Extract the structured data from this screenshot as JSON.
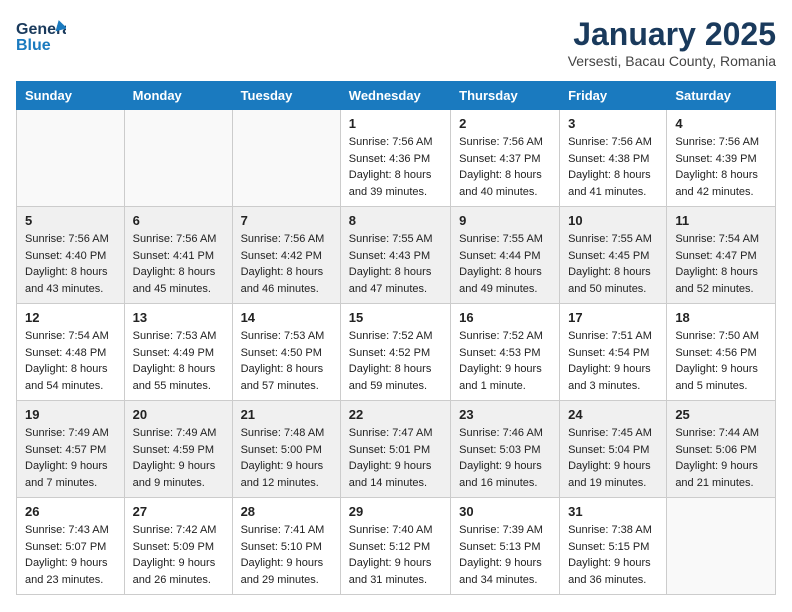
{
  "header": {
    "logo_general": "General",
    "logo_blue": "Blue",
    "title": "January 2025",
    "subtitle": "Versesti, Bacau County, Romania"
  },
  "weekdays": [
    "Sunday",
    "Monday",
    "Tuesday",
    "Wednesday",
    "Thursday",
    "Friday",
    "Saturday"
  ],
  "weeks": [
    [
      {
        "day": "",
        "info": ""
      },
      {
        "day": "",
        "info": ""
      },
      {
        "day": "",
        "info": ""
      },
      {
        "day": "1",
        "info": "Sunrise: 7:56 AM\nSunset: 4:36 PM\nDaylight: 8 hours\nand 39 minutes."
      },
      {
        "day": "2",
        "info": "Sunrise: 7:56 AM\nSunset: 4:37 PM\nDaylight: 8 hours\nand 40 minutes."
      },
      {
        "day": "3",
        "info": "Sunrise: 7:56 AM\nSunset: 4:38 PM\nDaylight: 8 hours\nand 41 minutes."
      },
      {
        "day": "4",
        "info": "Sunrise: 7:56 AM\nSunset: 4:39 PM\nDaylight: 8 hours\nand 42 minutes."
      }
    ],
    [
      {
        "day": "5",
        "info": "Sunrise: 7:56 AM\nSunset: 4:40 PM\nDaylight: 8 hours\nand 43 minutes."
      },
      {
        "day": "6",
        "info": "Sunrise: 7:56 AM\nSunset: 4:41 PM\nDaylight: 8 hours\nand 45 minutes."
      },
      {
        "day": "7",
        "info": "Sunrise: 7:56 AM\nSunset: 4:42 PM\nDaylight: 8 hours\nand 46 minutes."
      },
      {
        "day": "8",
        "info": "Sunrise: 7:55 AM\nSunset: 4:43 PM\nDaylight: 8 hours\nand 47 minutes."
      },
      {
        "day": "9",
        "info": "Sunrise: 7:55 AM\nSunset: 4:44 PM\nDaylight: 8 hours\nand 49 minutes."
      },
      {
        "day": "10",
        "info": "Sunrise: 7:55 AM\nSunset: 4:45 PM\nDaylight: 8 hours\nand 50 minutes."
      },
      {
        "day": "11",
        "info": "Sunrise: 7:54 AM\nSunset: 4:47 PM\nDaylight: 8 hours\nand 52 minutes."
      }
    ],
    [
      {
        "day": "12",
        "info": "Sunrise: 7:54 AM\nSunset: 4:48 PM\nDaylight: 8 hours\nand 54 minutes."
      },
      {
        "day": "13",
        "info": "Sunrise: 7:53 AM\nSunset: 4:49 PM\nDaylight: 8 hours\nand 55 minutes."
      },
      {
        "day": "14",
        "info": "Sunrise: 7:53 AM\nSunset: 4:50 PM\nDaylight: 8 hours\nand 57 minutes."
      },
      {
        "day": "15",
        "info": "Sunrise: 7:52 AM\nSunset: 4:52 PM\nDaylight: 8 hours\nand 59 minutes."
      },
      {
        "day": "16",
        "info": "Sunrise: 7:52 AM\nSunset: 4:53 PM\nDaylight: 9 hours\nand 1 minute."
      },
      {
        "day": "17",
        "info": "Sunrise: 7:51 AM\nSunset: 4:54 PM\nDaylight: 9 hours\nand 3 minutes."
      },
      {
        "day": "18",
        "info": "Sunrise: 7:50 AM\nSunset: 4:56 PM\nDaylight: 9 hours\nand 5 minutes."
      }
    ],
    [
      {
        "day": "19",
        "info": "Sunrise: 7:49 AM\nSunset: 4:57 PM\nDaylight: 9 hours\nand 7 minutes."
      },
      {
        "day": "20",
        "info": "Sunrise: 7:49 AM\nSunset: 4:59 PM\nDaylight: 9 hours\nand 9 minutes."
      },
      {
        "day": "21",
        "info": "Sunrise: 7:48 AM\nSunset: 5:00 PM\nDaylight: 9 hours\nand 12 minutes."
      },
      {
        "day": "22",
        "info": "Sunrise: 7:47 AM\nSunset: 5:01 PM\nDaylight: 9 hours\nand 14 minutes."
      },
      {
        "day": "23",
        "info": "Sunrise: 7:46 AM\nSunset: 5:03 PM\nDaylight: 9 hours\nand 16 minutes."
      },
      {
        "day": "24",
        "info": "Sunrise: 7:45 AM\nSunset: 5:04 PM\nDaylight: 9 hours\nand 19 minutes."
      },
      {
        "day": "25",
        "info": "Sunrise: 7:44 AM\nSunset: 5:06 PM\nDaylight: 9 hours\nand 21 minutes."
      }
    ],
    [
      {
        "day": "26",
        "info": "Sunrise: 7:43 AM\nSunset: 5:07 PM\nDaylight: 9 hours\nand 23 minutes."
      },
      {
        "day": "27",
        "info": "Sunrise: 7:42 AM\nSunset: 5:09 PM\nDaylight: 9 hours\nand 26 minutes."
      },
      {
        "day": "28",
        "info": "Sunrise: 7:41 AM\nSunset: 5:10 PM\nDaylight: 9 hours\nand 29 minutes."
      },
      {
        "day": "29",
        "info": "Sunrise: 7:40 AM\nSunset: 5:12 PM\nDaylight: 9 hours\nand 31 minutes."
      },
      {
        "day": "30",
        "info": "Sunrise: 7:39 AM\nSunset: 5:13 PM\nDaylight: 9 hours\nand 34 minutes."
      },
      {
        "day": "31",
        "info": "Sunrise: 7:38 AM\nSunset: 5:15 PM\nDaylight: 9 hours\nand 36 minutes."
      },
      {
        "day": "",
        "info": ""
      }
    ]
  ]
}
